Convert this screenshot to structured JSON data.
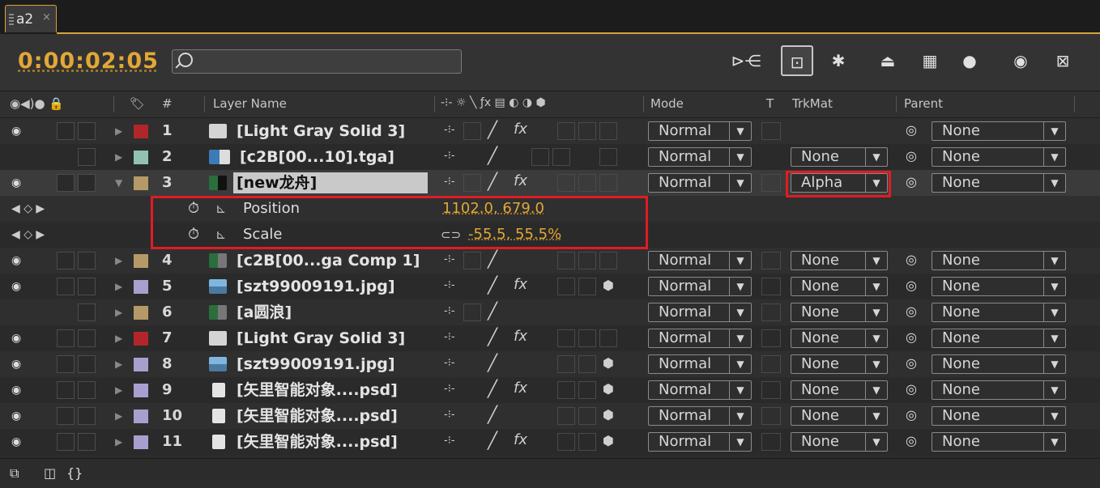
{
  "tab": {
    "label": "a2",
    "close": "×"
  },
  "timecode": "0:00:02:05",
  "search": {
    "placeholder": ""
  },
  "columns": {
    "layer_name": "Layer Name",
    "mode": "Mode",
    "t": "T",
    "trkmat": "TrkMat",
    "parent": "Parent"
  },
  "layers": [
    {
      "num": "1",
      "name": "[Light Gray Solid 3]",
      "color": "#b2262a",
      "fx": "fx",
      "mode": "Normal",
      "trkmat": "",
      "parent": "None",
      "eye": true
    },
    {
      "num": "2",
      "name": "[c2B[00...10].tga]",
      "color": "#92c3b1",
      "fx": "",
      "mode": "Normal",
      "trkmat": "None",
      "parent": "None",
      "eye": false
    },
    {
      "num": "3",
      "name": "[new龙舟]",
      "color": "#b59a68",
      "fx": "fx",
      "mode": "Normal",
      "trkmat": "Alpha",
      "parent": "None",
      "eye": true
    },
    {
      "num": "4",
      "name": "[c2B[00...ga Comp 1]",
      "color": "#b59a68",
      "fx": "",
      "mode": "Normal",
      "trkmat": "None",
      "parent": "None",
      "eye": true
    },
    {
      "num": "5",
      "name": "[szt99009191.jpg]",
      "color": "#a99fcf",
      "fx": "fx",
      "mode": "Normal",
      "trkmat": "None",
      "parent": "None",
      "eye": true
    },
    {
      "num": "6",
      "name": "[a圆浪]",
      "color": "#b59a68",
      "fx": "",
      "mode": "Normal",
      "trkmat": "None",
      "parent": "None",
      "eye": false
    },
    {
      "num": "7",
      "name": "[Light Gray Solid 3]",
      "color": "#b2262a",
      "fx": "fx",
      "mode": "Normal",
      "trkmat": "None",
      "parent": "None",
      "eye": true
    },
    {
      "num": "8",
      "name": "[szt99009191.jpg]",
      "color": "#a99fcf",
      "fx": "",
      "mode": "Normal",
      "trkmat": "None",
      "parent": "None",
      "eye": true
    },
    {
      "num": "9",
      "name": "[矢里智能对象....psd]",
      "color": "#a99fcf",
      "fx": "fx",
      "mode": "Normal",
      "trkmat": "None",
      "parent": "None",
      "eye": true
    },
    {
      "num": "10",
      "name": "[矢里智能对象....psd]",
      "color": "#a99fcf",
      "fx": "",
      "mode": "Normal",
      "trkmat": "None",
      "parent": "None",
      "eye": true
    },
    {
      "num": "11",
      "name": "[矢里智能对象....psd]",
      "color": "#a99fcf",
      "fx": "fx",
      "mode": "Normal",
      "trkmat": "None",
      "parent": "None",
      "eye": true
    }
  ],
  "properties": [
    {
      "name": "Position",
      "value": "1102.0, 679.0"
    },
    {
      "name": "Scale",
      "value": "-55.5, 55.5%"
    }
  ],
  "accent": "#e3a736",
  "highlight": "#e01c24"
}
